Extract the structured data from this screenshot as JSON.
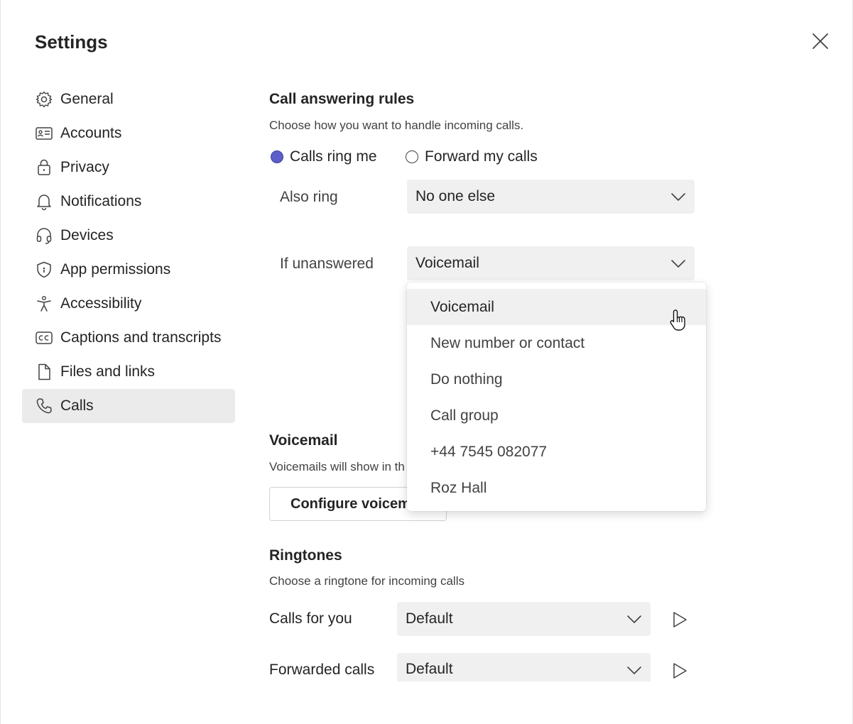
{
  "dialog": {
    "title": "Settings"
  },
  "sidebar": {
    "items": [
      {
        "label": "General",
        "icon": "gear-icon"
      },
      {
        "label": "Accounts",
        "icon": "id-card-icon"
      },
      {
        "label": "Privacy",
        "icon": "lock-icon"
      },
      {
        "label": "Notifications",
        "icon": "bell-icon"
      },
      {
        "label": "Devices",
        "icon": "headset-icon"
      },
      {
        "label": "App permissions",
        "icon": "shield-icon"
      },
      {
        "label": "Accessibility",
        "icon": "accessibility-icon"
      },
      {
        "label": "Captions and transcripts",
        "icon": "cc-icon"
      },
      {
        "label": "Files and links",
        "icon": "file-icon"
      },
      {
        "label": "Calls",
        "icon": "phone-icon"
      }
    ],
    "active": "Calls"
  },
  "call_answering": {
    "title": "Call answering rules",
    "description": "Choose how you want to handle incoming calls.",
    "options": {
      "ring_me": "Calls ring me",
      "forward": "Forward my calls"
    },
    "selected": "ring_me",
    "also_ring_label": "Also ring",
    "also_ring_value": "No one else",
    "if_unanswered_label": "If unanswered",
    "if_unanswered_value": "Voicemail"
  },
  "dropdown": {
    "items": [
      "Voicemail",
      "New number or contact",
      "Do nothing",
      "Call group",
      "+44 7545 082077",
      "Roz Hall"
    ],
    "hovered": "Voicemail"
  },
  "voicemail": {
    "title": "Voicemail",
    "description": "Voicemails will show in th",
    "configure_button": "Configure voicem"
  },
  "ringtones": {
    "title": "Ringtones",
    "description": "Choose a ringtone for incoming calls",
    "calls_for_you_label": "Calls for you",
    "calls_for_you_value": "Default",
    "forwarded_calls_label": "Forwarded calls",
    "forwarded_calls_value": "Default"
  },
  "colors": {
    "accent": "#5b5fc7",
    "active_nav_bg": "#ebebeb",
    "select_bg": "#f0f0f0"
  }
}
